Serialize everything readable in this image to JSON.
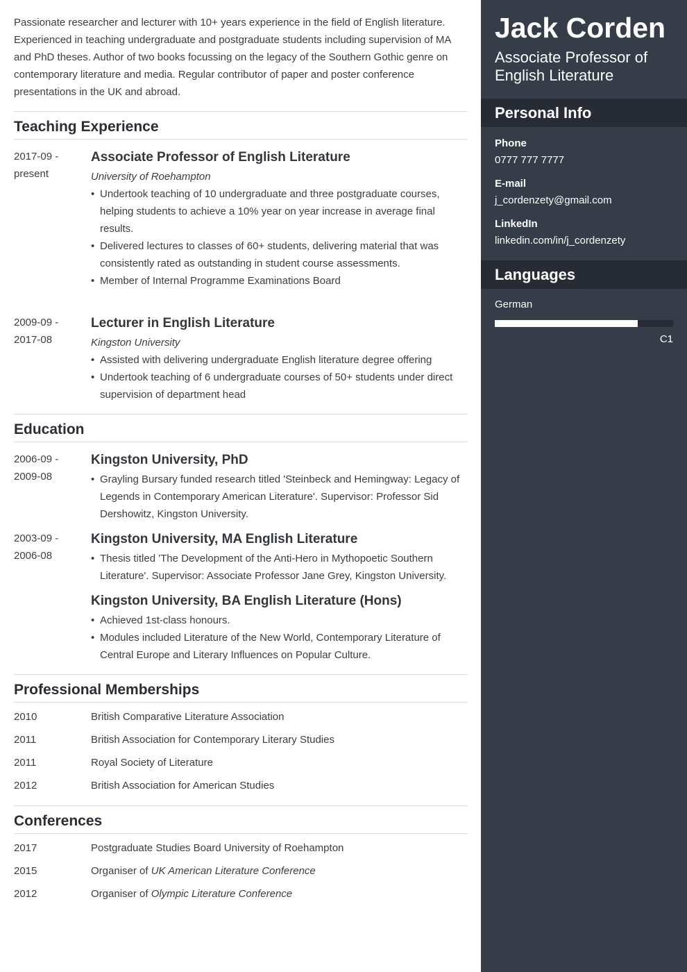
{
  "summary": "Passionate researcher and lecturer with 10+ years experience in the field of English literature. Experienced in teaching undergraduate and postgraduate students including supervision of MA and PhD theses. Author of two books focussing on the legacy of the Southern Gothic genre on contemporary literature and media. Regular contributor of paper and poster conference presentations in the UK and abroad.",
  "teaching": {
    "heading": "Teaching Experience",
    "entries": [
      {
        "date_start": "2017-09 -",
        "date_end": "present",
        "title": "Associate Professor of English Literature",
        "org": "University of Roehampton",
        "bullets": [
          "Undertook teaching of 10 undergraduate and three postgraduate courses, helping students to achieve a 10% year on year increase in average final results.",
          "Delivered lectures to classes of 60+ students, delivering material that was consistently rated as outstanding in student course assessments.",
          "Member of Internal Programme Examinations Board"
        ]
      },
      {
        "date_start": "2009-09 -",
        "date_end": "2017-08",
        "title": "Lecturer in English Literature",
        "org": "Kingston University",
        "bullets": [
          "Assisted with delivering undergraduate English literature degree offering",
          "Undertook teaching of 6 undergraduate courses of 50+ students under direct supervision of department head"
        ]
      }
    ]
  },
  "education": {
    "heading": "Education",
    "entries": [
      {
        "date_start": "2006-09 -",
        "date_end": "2009-08",
        "title": "Kingston University, PhD",
        "bullets": [
          "Grayling Bursary funded research titled 'Steinbeck and Hemingway: Legacy of Legends in Contemporary American Literature'. Supervisor: Professor Sid Dershowitz, Kingston University."
        ]
      },
      {
        "date_start": "2003-09 -",
        "date_end": "2006-08",
        "title": "Kingston University, MA English Literature",
        "bullets": [
          "Thesis titled 'The Development of the Anti-Hero in Mythopoetic Southern Literature'. Supervisor: Associate Professor Jane Grey, Kingston University."
        ]
      },
      {
        "date_start": "",
        "date_end": "",
        "title": "Kingston University, BA English Literature (Hons)",
        "bullets": [
          "Achieved 1st-class honours.",
          "Modules included Literature of the New World, Contemporary Literature of Central Europe and Literary Influences on Popular Culture."
        ]
      }
    ]
  },
  "memberships": {
    "heading": "Professional Memberships",
    "rows": [
      {
        "year": "2010",
        "text": "British Comparative Literature Association"
      },
      {
        "year": "2011",
        "text": "British Association for Contemporary Literary Studies"
      },
      {
        "year": "2011",
        "text": "Royal Society of Literature"
      },
      {
        "year": "2012",
        "text": "British Association for American Studies"
      }
    ]
  },
  "conferences": {
    "heading": "Conferences",
    "rows": [
      {
        "year": "2017",
        "prefix": "Postgraduate Studies Board University of Roehampton",
        "italic": ""
      },
      {
        "year": "2015",
        "prefix": "Organiser of ",
        "italic": "UK American Literature Conference"
      },
      {
        "year": "2012",
        "prefix": "Organiser of ",
        "italic": "Olympic Literature Conference"
      }
    ]
  },
  "sidebar": {
    "name": "Jack Corden",
    "role": "Associate Professor of English Literature",
    "personal_heading": "Personal Info",
    "phone_label": "Phone",
    "phone": "0777 777 7777",
    "email_label": "E-mail",
    "email": "j_cordenzety@gmail.com",
    "linkedin_label": "LinkedIn",
    "linkedin": "linkedin.com/in/j_cordenzety",
    "languages_heading": "Languages",
    "languages": [
      {
        "name": "German",
        "level": "C1",
        "proficiency": 0.8
      }
    ]
  },
  "colors": {
    "sidebar_bg": "#373d48",
    "sidebar_head_bg": "#272b33",
    "text": "#3a3d42"
  }
}
